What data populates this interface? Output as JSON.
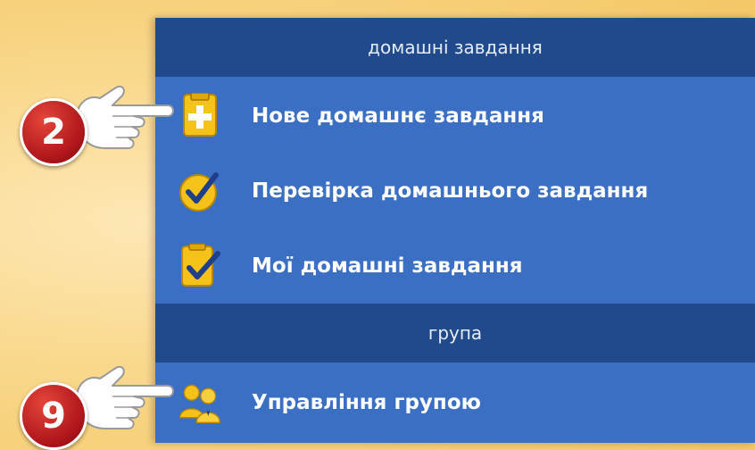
{
  "sections": [
    {
      "header": "домашні завдання",
      "items": [
        {
          "label": "Нове домашнє завдання",
          "icon": "new-homework-icon"
        },
        {
          "label": "Перевірка домашнього завдання",
          "icon": "checkmark-icon"
        },
        {
          "label": "Мої домашні завдання",
          "icon": "my-homework-icon"
        }
      ]
    },
    {
      "header": "група",
      "items": [
        {
          "label": "Управління групою",
          "icon": "group-users-icon"
        }
      ]
    }
  ],
  "callouts": [
    {
      "number": "2",
      "icon": "pointing-hand-icon"
    },
    {
      "number": "9",
      "icon": "pointing-hand-icon"
    }
  ],
  "colors": {
    "panel_background": "#3a6fc4",
    "section_header_background": "#214a8c",
    "page_background": "#f9d98e",
    "icon_yellow": "#f5c21a",
    "badge_red": "#b0161b"
  }
}
